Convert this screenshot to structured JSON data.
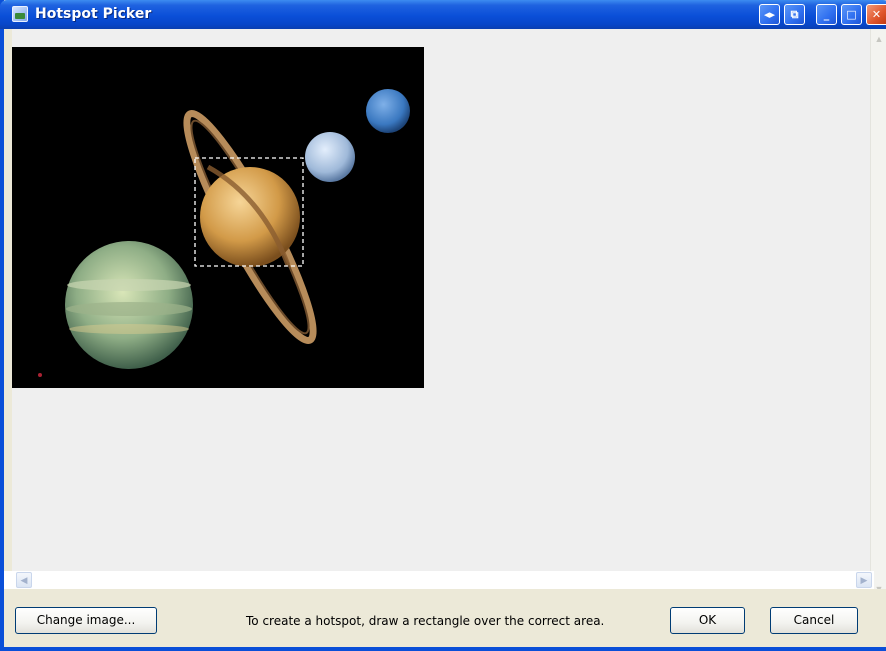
{
  "window": {
    "title": "Hotspot Picker",
    "title_buttons": [
      {
        "name": "resize-toggle-button",
        "glyph": "◂▸"
      },
      {
        "name": "restore-layout-button",
        "glyph": "⧉"
      },
      {
        "name": "minimize-button",
        "glyph": "_"
      },
      {
        "name": "maximize-button",
        "glyph": "□"
      },
      {
        "name": "close-button",
        "glyph": "✕"
      }
    ]
  },
  "image": {
    "description_icon": "planets-image",
    "selection": {
      "shape": "rectangle",
      "style": "dashed",
      "color": "#ffffff"
    }
  },
  "scrollbars": {
    "vertical": {
      "up_glyph": "▲",
      "down_glyph": "▼"
    },
    "horizontal": {
      "left_glyph": "◀",
      "right_glyph": "▶"
    }
  },
  "footer": {
    "change_image_label": "Change image...",
    "hint": "To create a hotspot, draw a rectangle over the correct area.",
    "ok_label": "OK",
    "cancel_label": "Cancel"
  },
  "colors": {
    "titlebar": "#0a4fd8",
    "background": "#ece9d8",
    "canvas": "#efefef"
  }
}
